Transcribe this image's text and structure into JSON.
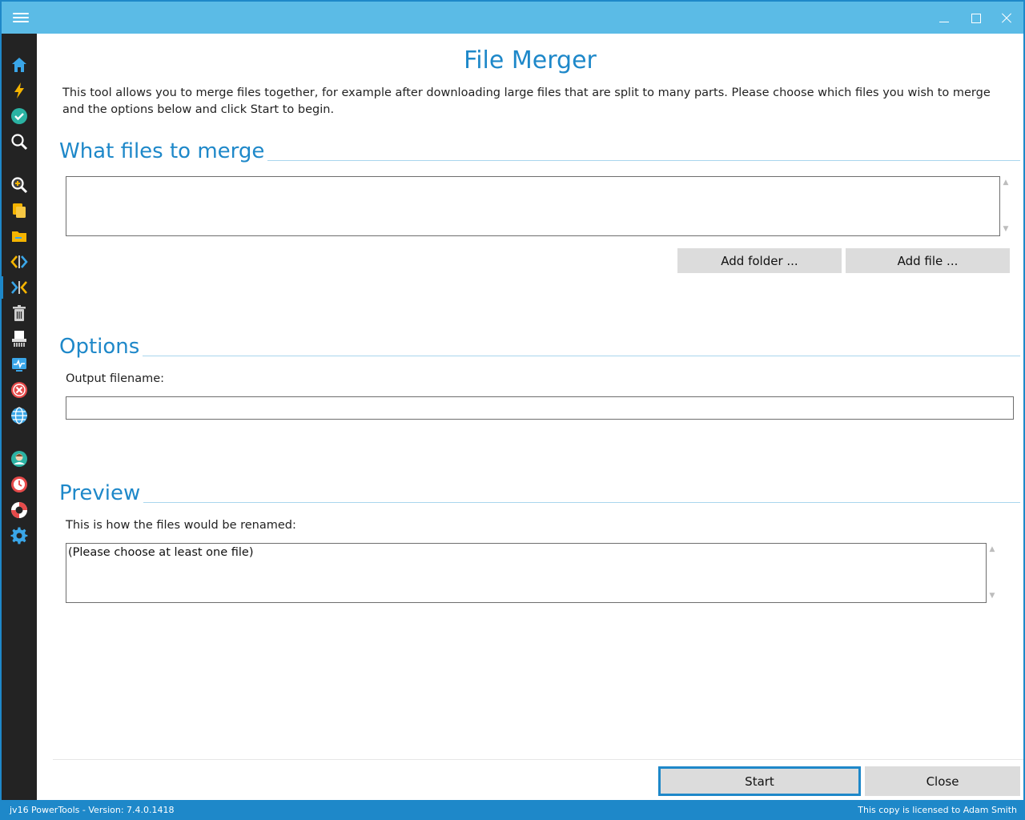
{
  "window": {
    "title": "File Merger",
    "controls": [
      "minimize",
      "maximize",
      "close"
    ]
  },
  "sidebar": {
    "items": [
      {
        "name": "home-icon",
        "color": "#3aa6e8"
      },
      {
        "name": "lightning-icon",
        "color": "#f5b400"
      },
      {
        "name": "checkmark-icon",
        "color": "#2bb3a3"
      },
      {
        "name": "search-icon",
        "color": "#ffffff"
      },
      {
        "name": "zoom-in-icon",
        "color": "#ffffff"
      },
      {
        "name": "copy-icon",
        "color": "#f5b400"
      },
      {
        "name": "folder-icon",
        "color": "#f5b400"
      },
      {
        "name": "split-icon",
        "color": "#f5b400"
      },
      {
        "name": "merge-icon",
        "color": "#3aa6e8"
      },
      {
        "name": "trash-icon",
        "color": "#cfcfcf"
      },
      {
        "name": "shredder-icon",
        "color": "#ffffff"
      },
      {
        "name": "monitor-icon",
        "color": "#3aa6e8"
      },
      {
        "name": "error-icon",
        "color": "#e64a4a"
      },
      {
        "name": "globe-icon",
        "color": "#3aa6e8"
      },
      {
        "name": "user-icon",
        "color": "#2bb3a3"
      },
      {
        "name": "clock-icon",
        "color": "#e64a4a"
      },
      {
        "name": "lifebuoy-icon",
        "color": "#e64a4a"
      },
      {
        "name": "gear-icon",
        "color": "#3aa6e8"
      }
    ],
    "active_item": "merge-icon"
  },
  "main": {
    "title": "File Merger",
    "intro": "This tool allows you to merge files together, for example after downloading large files that are split to many parts. Please choose which files you wish to merge and the options below and click Start to begin.",
    "files_section": {
      "heading": "What files to merge",
      "files_value": "",
      "add_folder_label": "Add folder ...",
      "add_file_label": "Add file ..."
    },
    "options_section": {
      "heading": "Options",
      "output_label": "Output filename:",
      "output_value": ""
    },
    "preview_section": {
      "heading": "Preview",
      "preview_label": "This is how the files would be renamed:",
      "preview_value": "(Please choose at least one file)"
    },
    "start_label": "Start",
    "close_label": "Close"
  },
  "statusbar": {
    "version": "jv16 PowerTools - Version: 7.4.0.1418",
    "license": "This copy is licensed to Adam Smith"
  },
  "colors": {
    "accent": "#1e88c9",
    "titlebar": "#5bbbe6",
    "sidebar": "#232323"
  }
}
